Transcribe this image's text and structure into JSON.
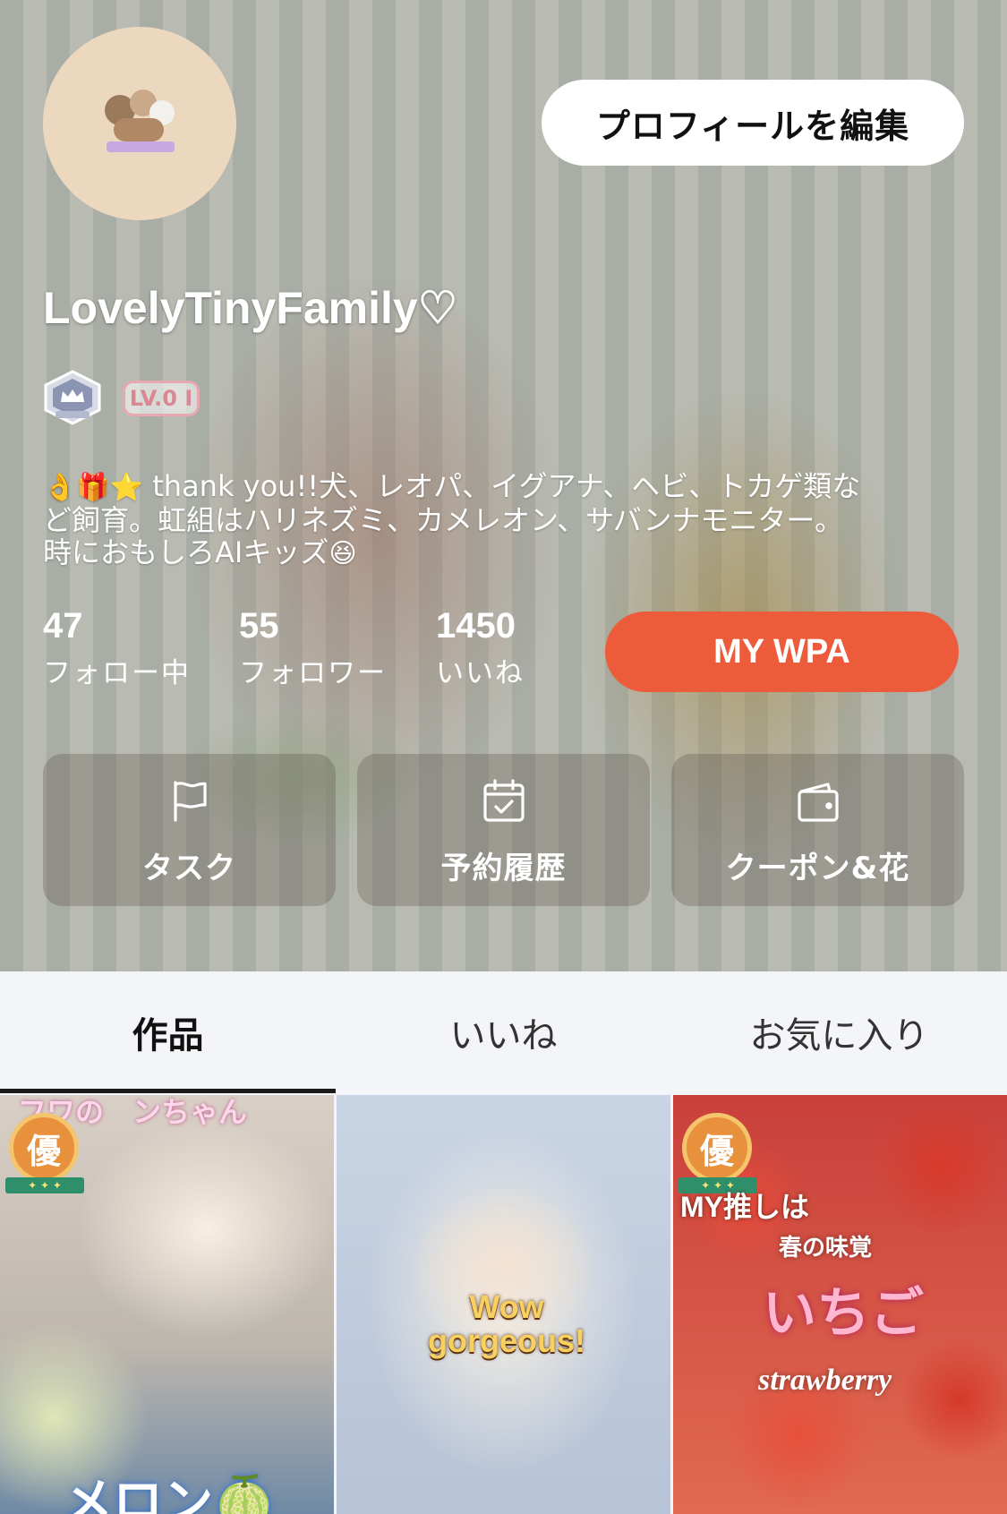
{
  "profile": {
    "username": "LovelyTinyFamily♡",
    "edit_button_label": "プロフィールを編集",
    "level_badge": "LV.0 I",
    "bio_line1_emoji": "👌🎁⭐",
    "bio_line1_text": " thank you!!犬、レオパ、イグアナ、ヘビ、トカゲ類な",
    "bio_line2": "ど飼育。虹組はハリネズミ、カメレオン、サバンナモニター。",
    "bio_line3_text": "時におもしろAIキッズ",
    "bio_line3_emoji": "😆"
  },
  "stats": [
    {
      "value": "47",
      "label": "フォロー中"
    },
    {
      "value": "55",
      "label": "フォロワー"
    },
    {
      "value": "1450",
      "label": "いいね"
    }
  ],
  "wpa_button_label": "MY WPA",
  "quick_actions": [
    {
      "label": "タスク",
      "icon": "flag-icon"
    },
    {
      "label": "予約履歴",
      "icon": "calendar-check-icon"
    },
    {
      "label": "クーポン&花",
      "icon": "wallet-icon"
    }
  ],
  "tabs": [
    {
      "label": "作品",
      "active": true
    },
    {
      "label": "いいね",
      "active": false
    },
    {
      "label": "お気に入り",
      "active": false
    }
  ],
  "posts": [
    {
      "badge": "優",
      "overlay_top": "フワの　ンちゃん",
      "overlay_bottom": "メロン🍈"
    },
    {
      "overlay_line1": "Wow",
      "overlay_line2": "gorgeous!"
    },
    {
      "badge": "優",
      "overlay_side": "MY推しは",
      "overlay_spring": "春の味覚",
      "overlay_main": "いちご",
      "overlay_script": "strawberry"
    }
  ],
  "colors": {
    "accent": "#ec5c3b",
    "tab_indicator": "#1a1a1a",
    "badge_orange": "#e8913d"
  }
}
